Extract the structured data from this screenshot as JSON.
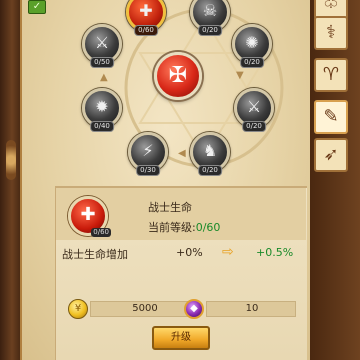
{
  "top_left_button": {
    "icon": "check-icon",
    "glyph": "✓"
  },
  "skill_tree": {
    "center": {
      "icon": "axe-icon",
      "glyph": "✠"
    },
    "nodes": [
      {
        "id": "n1",
        "level": "0/60",
        "glyph": "✚",
        "active": true
      },
      {
        "id": "n2",
        "level": "0/20",
        "glyph": "☠",
        "active": false
      },
      {
        "id": "n3",
        "level": "0/20",
        "glyph": "✺",
        "active": false
      },
      {
        "id": "n4",
        "level": "0/20",
        "glyph": "⚔",
        "active": false
      },
      {
        "id": "n5",
        "level": "0/20",
        "glyph": "♞",
        "active": false
      },
      {
        "id": "n6",
        "level": "0/30",
        "glyph": "⚡",
        "active": false
      },
      {
        "id": "n7",
        "level": "0/40",
        "glyph": "✹",
        "active": false
      },
      {
        "id": "n8",
        "level": "0/50",
        "glyph": "⚔",
        "active": false
      }
    ]
  },
  "side_tabs": [
    {
      "icon": "wings-icon",
      "glyph": "♧"
    },
    {
      "icon": "staff-icon",
      "glyph": "⚕"
    },
    {
      "icon": "horns-icon",
      "glyph": "♈"
    },
    {
      "icon": "carrot-icon",
      "glyph": "✎"
    },
    {
      "icon": "bow-icon",
      "glyph": "➶"
    }
  ],
  "info": {
    "icon_level": "0/60",
    "skill_name": "战士生命",
    "current_level_label": "当前等级:",
    "current_level_value": "0/60",
    "stat_label": "战士生命增加",
    "stat_from": "+0%",
    "stat_arrow": "⇨",
    "stat_to": "+0.5%",
    "cost_gold": "5000",
    "cost_gem": "10",
    "upgrade_label": "升级"
  }
}
